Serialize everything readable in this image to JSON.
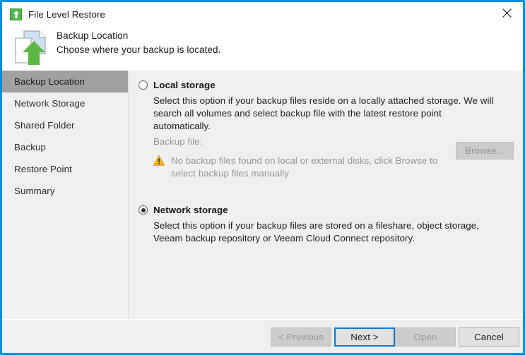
{
  "window": {
    "title": "File Level Restore",
    "title_icon": "restore-app-icon",
    "close_icon": "close-icon",
    "accent_border_color": "#0a8ddf"
  },
  "header": {
    "icon": "documents-restore-icon",
    "title": "Backup Location",
    "subtitle": "Choose where your backup is located."
  },
  "sidebar": {
    "items": [
      {
        "label": "Backup Location",
        "active": true
      },
      {
        "label": "Network Storage",
        "active": false
      },
      {
        "label": "Shared Folder",
        "active": false
      },
      {
        "label": "Backup",
        "active": false
      },
      {
        "label": "Restore Point",
        "active": false
      },
      {
        "label": "Summary",
        "active": false
      }
    ],
    "active_background": "#a0a0a0"
  },
  "main": {
    "options": [
      {
        "name": "local-storage",
        "label": "Local storage",
        "selected": false,
        "description": "Select this option if your backup files reside on a locally attached storage. We will search all volumes and select backup file with the latest restore point automatically.",
        "sub_label": "Backup file:",
        "warning_icon": "warning-triangle-icon",
        "warning_color": "#f5b324",
        "warning_text": "No backup files found on local or external disks, click Browse to select backup files manually",
        "browse_label": "Browse...",
        "browse_enabled": false
      },
      {
        "name": "network-storage",
        "label": "Network storage",
        "selected": true,
        "description": "Select this option if your backup files are stored on a fileshare, object storage, Veeam backup repository or Veeam Cloud Connect repository."
      }
    ]
  },
  "footer": {
    "buttons": [
      {
        "name": "previous",
        "label": "< Previous",
        "enabled": false,
        "focused": false
      },
      {
        "name": "next",
        "label": "Next >",
        "enabled": true,
        "focused": true
      },
      {
        "name": "open",
        "label": "Open",
        "enabled": false,
        "focused": false
      },
      {
        "name": "cancel",
        "label": "Cancel",
        "enabled": true,
        "focused": false
      }
    ],
    "focus_color": "#0078d7"
  }
}
